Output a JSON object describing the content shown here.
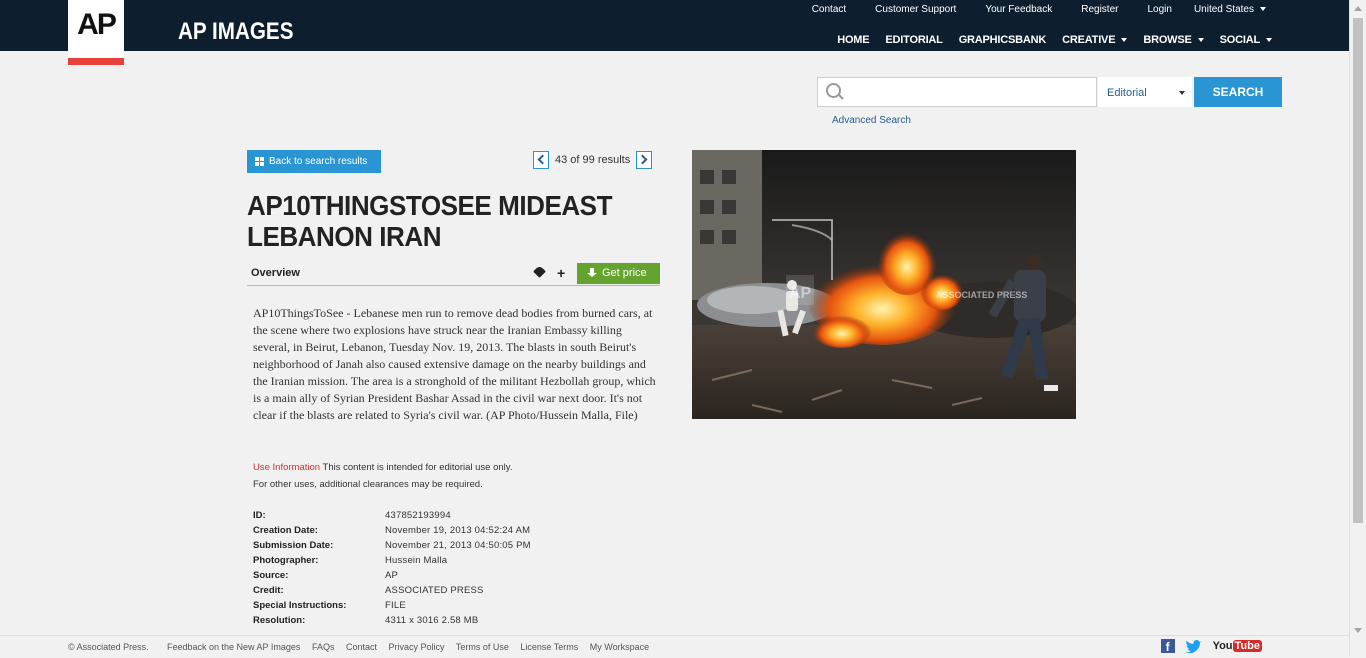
{
  "header": {
    "logo": "AP",
    "brand": "AP IMAGES",
    "utility": [
      "Contact",
      "Customer Support",
      "Your Feedback",
      "Register",
      "Login"
    ],
    "country": "United States",
    "nav": [
      "HOME",
      "EDITORIAL",
      "GRAPHICSBANK",
      "CREATIVE",
      "BROWSE",
      "SOCIAL"
    ]
  },
  "search": {
    "placeholder": "",
    "scope": "Editorial",
    "button": "SEARCH",
    "advanced": "Advanced Search"
  },
  "nav_results": {
    "back": "Back to search results",
    "position": "43 of 99 results"
  },
  "asset": {
    "title": "AP10THINGSTOSEE MIDEAST LEBANON IRAN",
    "tab": "Overview",
    "price_button": "Get price",
    "description": "AP10ThingsToSee - Lebanese men run to remove dead bodies from burned cars, at the scene where two explosions have struck near the Iranian Embassy killing several, in Beirut, Lebanon, Tuesday Nov. 19, 2013. The blasts in south Beirut's neighborhood of Janah also caused extensive damage on the nearby buildings and the Iranian mission. The area is a stronghold of the militant Hezbollah group, which is a main ally of Syrian President Bashar Assad in the civil war next door. It's not clear if the blasts are related to Syria's civil war. (AP Photo/Hussein Malla, File)",
    "use_info_label": "Use Information",
    "use_info_text": " This content is intended for editorial use only.",
    "use_info_line2": "For other uses, additional clearances may be required.",
    "metadata": [
      {
        "k": "ID:",
        "v": "437852193994"
      },
      {
        "k": "Creation Date:",
        "v": "November 19, 2013 04:52:24 AM"
      },
      {
        "k": "Submission Date:",
        "v": "November 21, 2013 04:50:05 PM"
      },
      {
        "k": "Photographer:",
        "v": "Hussein Malla"
      },
      {
        "k": "Source:",
        "v": "AP"
      },
      {
        "k": "Credit:",
        "v": "ASSOCIATED PRESS"
      },
      {
        "k": "Special Instructions:",
        "v": "FILE"
      },
      {
        "k": "Resolution:",
        "v": "4311 x 3016 2.58 MB"
      }
    ],
    "watermark": "AP",
    "watermark_text": "ASSOCIATED PRESS"
  },
  "footer": {
    "copyright": "© Associated Press.",
    "links": [
      "Feedback on the New AP Images",
      "FAQs",
      "Contact",
      "Privacy Policy",
      "Terms of Use",
      "License Terms",
      "My Workspace"
    ],
    "social": [
      "facebook-icon",
      "twitter-icon",
      "youtube-icon"
    ],
    "youtube_label": "You",
    "youtube_tube": "Tube"
  },
  "colors": {
    "header_bg": "#0d1e2f",
    "accent_blue": "#2995d3",
    "price_green": "#64a32e",
    "logo_red": "#e8403b"
  }
}
